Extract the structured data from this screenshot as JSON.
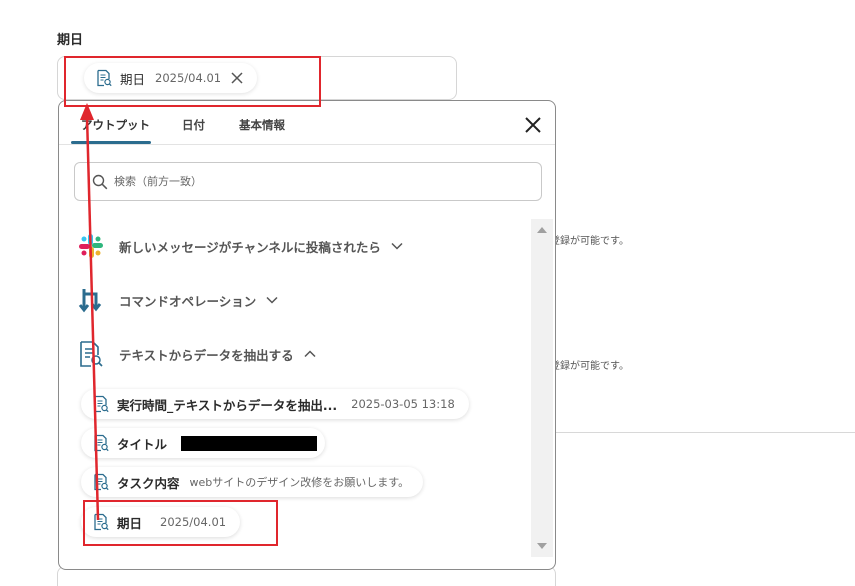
{
  "field": {
    "label": "期日",
    "selected_chip": {
      "name": "期日",
      "value": "2025/04.01"
    }
  },
  "background": {
    "note_1": "登録が可能です。",
    "note_2": "登録が可能です。"
  },
  "panel": {
    "tabs": [
      {
        "label": "アウトプット",
        "active": true
      },
      {
        "label": "日付",
        "active": false
      },
      {
        "label": "基本情報",
        "active": false
      }
    ],
    "search": {
      "placeholder": "検索（前方一致）",
      "value": ""
    },
    "groups": [
      {
        "label": "新しいメッセージがチャンネルに投稿されたら",
        "icon": "slack-icon",
        "expanded": false
      },
      {
        "label": "コマンドオペレーション",
        "icon": "command-operation-icon",
        "expanded": false
      },
      {
        "label": "テキストからデータを抽出する",
        "icon": "extract-data-icon",
        "expanded": true
      }
    ],
    "items": [
      {
        "name": "実行時間_テキストからデータを抽出...",
        "value": "2025-03-05 13:18"
      },
      {
        "name": "タイトル",
        "value": ""
      },
      {
        "name": "タスク内容",
        "value": "webサイトのデザイン改修をお願いします。"
      },
      {
        "name": "期日",
        "value": "2025/04.01"
      }
    ]
  },
  "colors": {
    "accent": "#2b6c8e",
    "annotation": "#e0262d",
    "icon_blue": "#2b6c8e"
  }
}
